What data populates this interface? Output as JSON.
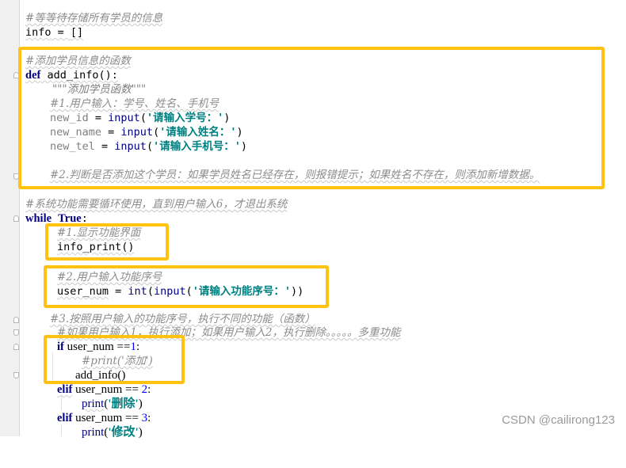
{
  "editor": {
    "lines": {
      "l1_comment": "#等等待存储所有学员的信息",
      "l2_var": "info",
      "l2_op": " = ",
      "l2_val": "[]",
      "l3_comment": "#添加学员信息的函数",
      "l4_kw": "def",
      "l4_rest": " add_info():",
      "l5_doc": "\"\"\"添加学员函数\"\"\"",
      "l6_comment": "#1.用户输入：学号、姓名、手机号",
      "l7_var": "new_id",
      "l7_op": " = ",
      "l7_fn": "input",
      "l7_open": "(",
      "l7_str": "'请输入学号：'",
      "l7_close": ")",
      "l8_var": "new_name",
      "l8_op": " = ",
      "l8_fn": "input",
      "l8_open": "(",
      "l8_str": "'请输入姓名：'",
      "l8_close": ")",
      "l9_var": "new_tel",
      "l9_op": " = ",
      "l9_fn": "input",
      "l9_open": "(",
      "l9_str": "'请输入手机号：'",
      "l9_close": ")",
      "l10_comment": "#2.判断是否添加这个学员：如果学员姓名已经存在，则报错提示；如果姓名不存在，则添加新增数据。",
      "l11_comment": "#系统功能需要循环使用，直到用户输入6，才退出系统",
      "l12_kw": "while",
      "l12_sp": " ",
      "l12_kw2": "True",
      "l12_colon": ":",
      "l13_comment": "#1.显示功能界面",
      "l14_code": "info_print()",
      "l15_comment": "#2.用户输入功能序号",
      "l16_var": "user_num",
      "l16_op": " = ",
      "l16_fn1": "int",
      "l16_open1": "(",
      "l16_fn2": "input",
      "l16_open2": "(",
      "l16_str": "'请输入功能序号：'",
      "l16_close": "))",
      "l17_comment": "#3.按照用户输入的功能序号，执行不同的功能（函数）",
      "l18_comment": "#如果用户输入1，执行添加；如果用户输入2，执行删除。。。。。多重功能",
      "l19_kw": "if",
      "l19_rest": " user_num ==",
      "l19_num": "1",
      "l19_colon": ":",
      "l20_comment": "#print('添加')",
      "l21_code": "add_info()",
      "l22_kw": "elif",
      "l22_rest": " user_num == ",
      "l22_num": "2",
      "l22_colon": ":",
      "l23_fn": "print",
      "l23_open": "(",
      "l23_str": "'删除'",
      "l23_close": ")",
      "l24_kw": "elif",
      "l24_rest": " user_num == ",
      "l24_num": "3",
      "l24_colon": ":",
      "l25_fn": "print",
      "l25_open": "(",
      "l25_str": "'修改'",
      "l25_close": ")"
    }
  },
  "watermark": "CSDN @cailirong123",
  "colors": {
    "highlight_box": "#ffc20e",
    "keyword": "#000080",
    "string": "#008080",
    "comment": "#8c8c8c",
    "number": "#0000ff"
  }
}
